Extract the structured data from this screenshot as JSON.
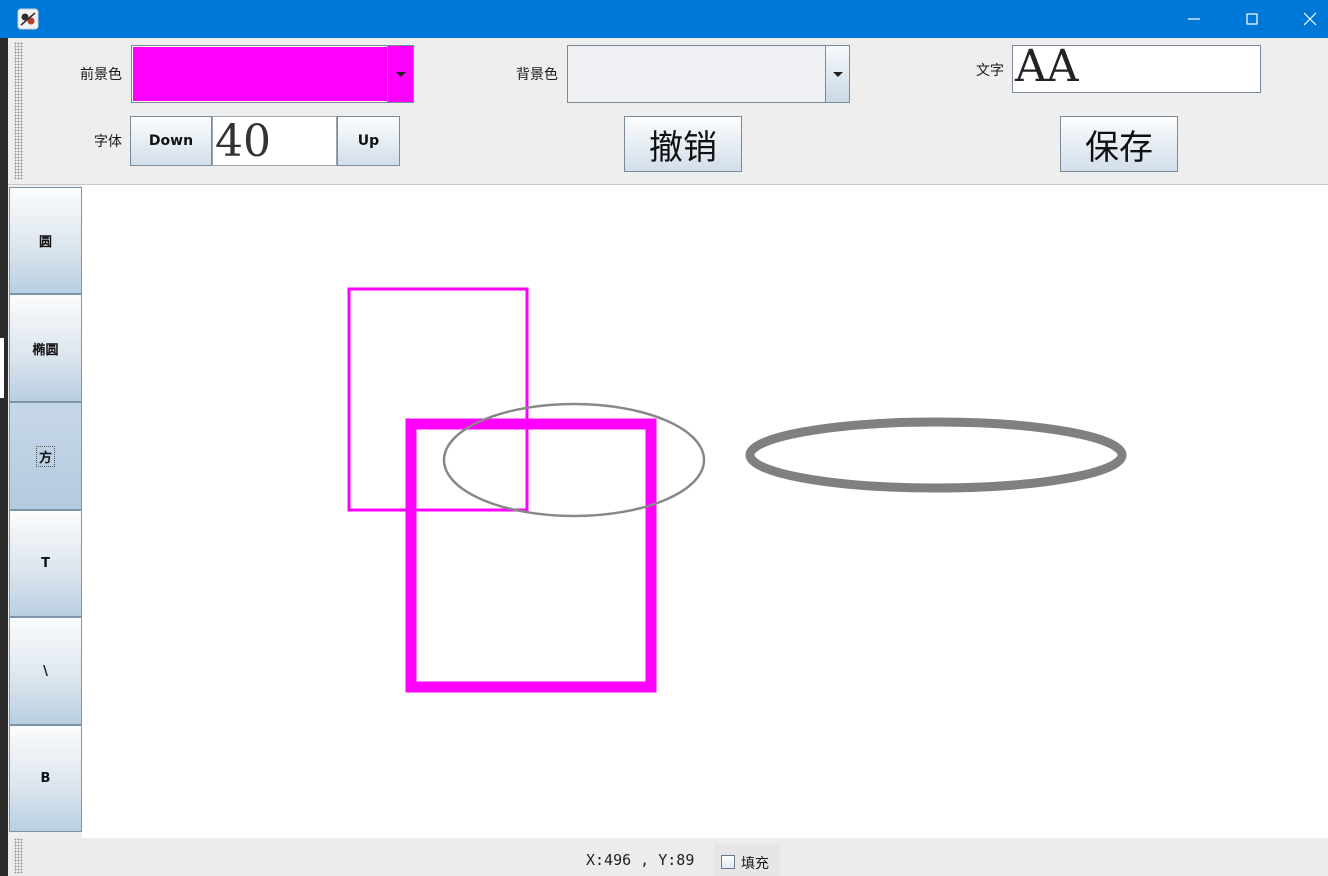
{
  "window": {
    "icon": "java-app-icon",
    "controls": [
      "minimize-icon",
      "maximize-icon",
      "close-icon"
    ]
  },
  "toolbar": {
    "foreground_label": "前景色",
    "foreground_color": "#ff00ff",
    "background_label": "背景色",
    "background_color": "#eef0f3",
    "text_label": "文字",
    "text_value": "AA",
    "font_label": "字体",
    "font_down_label": "Down",
    "font_size": "40",
    "font_up_label": "Up",
    "undo_label": "撤销",
    "save_label": "保存"
  },
  "tools": [
    {
      "label": "圆"
    },
    {
      "label": "椭圆"
    },
    {
      "label": "方"
    },
    {
      "label": "T"
    },
    {
      "label": "\\"
    },
    {
      "label": "B"
    }
  ],
  "canvas": {
    "shapes": [
      {
        "type": "rectangle",
        "stroke": "#ff00ff"
      },
      {
        "type": "rectangle",
        "stroke": "#ff00ff"
      },
      {
        "type": "ellipse",
        "stroke": "#888888"
      },
      {
        "type": "ellipse",
        "stroke": "#808080"
      }
    ]
  },
  "status": {
    "coords": "X:496 , Y:89",
    "fill_label": "填充",
    "fill_checked": false
  }
}
